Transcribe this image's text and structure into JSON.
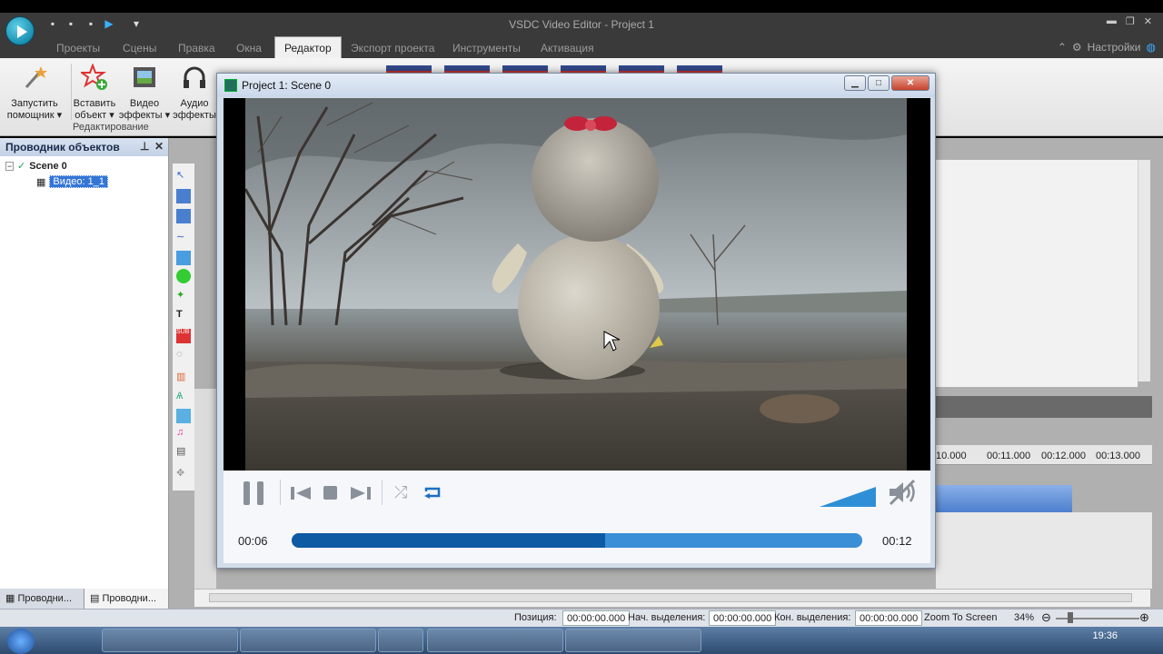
{
  "app": {
    "window_title": "VSDC Video Editor - Project 1"
  },
  "menu": {
    "tabs": [
      "Проекты",
      "Сцены",
      "Правка",
      "Окна",
      "Редактор",
      "Экспорт проекта",
      "Инструменты",
      "Активация"
    ],
    "active_tab": "Редактор",
    "settings_label": "Настройки"
  },
  "ribbon": {
    "buttons": [
      {
        "line1": "Запустить",
        "line2": "помощник"
      },
      {
        "line1": "Вставить",
        "line2": "объект"
      },
      {
        "line1": "Видео",
        "line2": "эффекты"
      },
      {
        "line1": "Аудио",
        "line2": "эффекты"
      }
    ],
    "group_label": "Редактирование"
  },
  "explorer": {
    "title": "Проводник объектов",
    "scene": "Scene 0",
    "item": "Видео: 1_1",
    "tabs": [
      "Проводни...",
      "Проводни..."
    ]
  },
  "player": {
    "title": "Project 1: Scene 0",
    "current_time": "00:06",
    "total_time": "00:12",
    "progress": 0.55
  },
  "timeline": {
    "ruler_labels": [
      "10.000",
      "00:11.000",
      "00:12.000",
      "00:13.000"
    ]
  },
  "status": {
    "position_label": "Позиция:",
    "position_value": "00:00:00.000",
    "sel_start_label": "Нач. выделения:",
    "sel_start_value": "00:00:00.000",
    "sel_end_label": "Кон. выделения:",
    "sel_end_value": "00:00:00.000",
    "zoom_to_screen": "Zoom To Screen",
    "zoom_percent": "34%"
  },
  "taskbar": {
    "clock": "19:36"
  },
  "colors": {
    "progress_played": "#0e5aa3",
    "progress_rest": "#3b8fd6",
    "menubar": "#3a3a3a",
    "selection": "#3375d6"
  }
}
